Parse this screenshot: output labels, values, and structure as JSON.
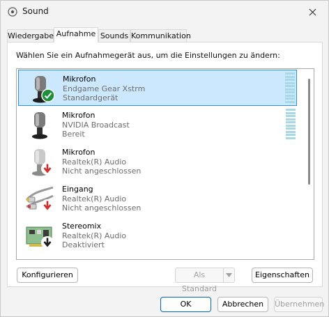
{
  "window": {
    "title": "Sound"
  },
  "tabs": [
    {
      "label": "Wiedergabe"
    },
    {
      "label": "Aufnahme"
    },
    {
      "label": "Sounds"
    },
    {
      "label": "Kommunikation"
    }
  ],
  "panel": {
    "instruction": "Wählen Sie ein Aufnahmegerät aus, um die Einstellungen zu ändern:"
  },
  "devices": [
    {
      "name": "Mikrofon",
      "description": "Endgame Gear Xstrm",
      "status": "Standardgerät",
      "icon": "microphone-icon",
      "badge": "default-check-icon",
      "selected": true
    },
    {
      "name": "Mikrofon",
      "description": "NVIDIA Broadcast",
      "status": "Bereit",
      "icon": "microphone-icon",
      "badge": "",
      "selected": false
    },
    {
      "name": "Mikrofon",
      "description": "Realtek(R) Audio",
      "status": "Nicht angeschlossen",
      "icon": "microphone-icon",
      "badge": "unplugged-icon",
      "selected": false
    },
    {
      "name": "Eingang",
      "description": "Realtek(R) Audio",
      "status": "Nicht angeschlossen",
      "icon": "line-in-cable-icon",
      "badge": "unplugged-icon",
      "selected": false
    },
    {
      "name": "Stereomix",
      "description": "Realtek(R) Audio",
      "status": "Deaktiviert",
      "icon": "soundcard-icon",
      "badge": "disabled-icon",
      "selected": false
    }
  ],
  "buttons": {
    "configure": "Konfigurieren",
    "set_default": "Als Standard",
    "properties": "Eigenschaften",
    "ok": "OK",
    "cancel": "Abbrechen",
    "apply": "Übernehmen"
  },
  "colors": {
    "selection": "#cce8ff",
    "selection_border": "#2e8fdc",
    "level_meter": "#a8d7e6",
    "default_check": "#1e8f3a",
    "unplugged_badge": "#d12a2a",
    "accent": "#0067c0"
  }
}
